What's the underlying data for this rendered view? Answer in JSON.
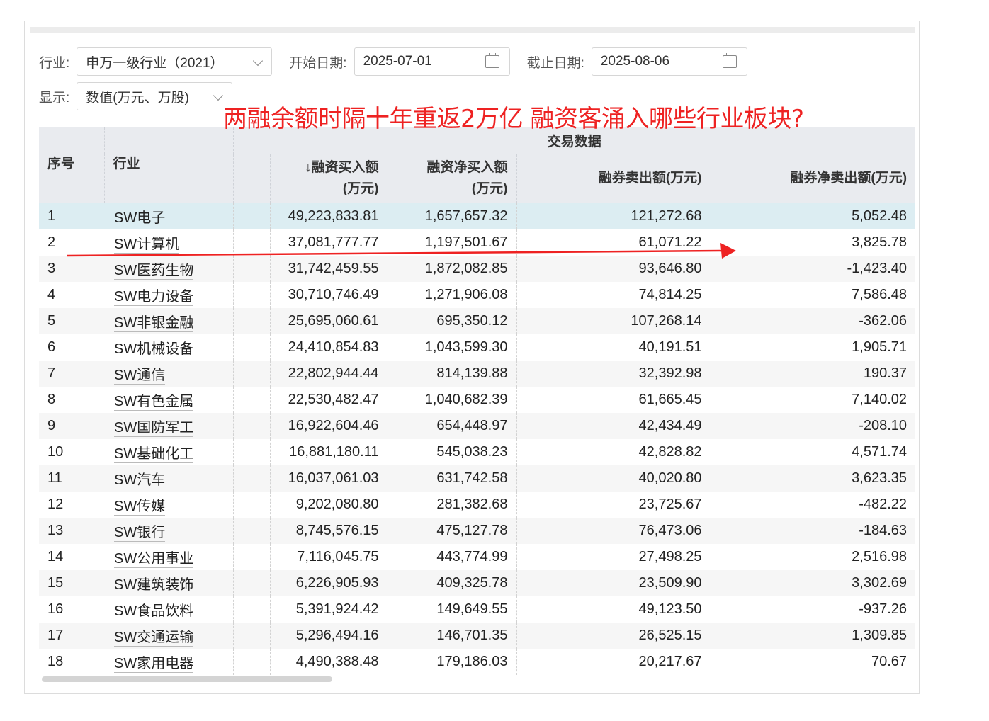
{
  "filters": {
    "industry_label": "行业:",
    "industry_value": "申万一级行业（2021）",
    "start_label": "开始日期:",
    "start_value": "2025-07-01",
    "end_label": "截止日期:",
    "end_value": "2025-08-06",
    "display_label": "显示:",
    "display_value": "数值(万元、万股)"
  },
  "overlay_title": "两融余额时隔十年重返2万亿 融资客涌入哪些行业板块?",
  "table": {
    "headers": {
      "index": "序号",
      "industry": "行业",
      "group": "交易数据",
      "margin_buy_l1": "↓融资买入额",
      "margin_buy_l2": "(万元)",
      "net_buy_l1": "融资净买入额",
      "net_buy_l2": "(万元)",
      "short_sell": "融券卖出额(万元)",
      "net_short_sell": "融券净卖出额(万元)"
    },
    "rows": [
      {
        "idx": "1",
        "industry": "SW电子",
        "buy": "49,223,833.81",
        "net_buy": "1,657,657.32",
        "short": "121,272.68",
        "net_short": "5,052.48"
      },
      {
        "idx": "2",
        "industry": "SW计算机",
        "buy": "37,081,777.77",
        "net_buy": "1,197,501.67",
        "short": "61,071.22",
        "net_short": "3,825.78"
      },
      {
        "idx": "3",
        "industry": "SW医药生物",
        "buy": "31,742,459.55",
        "net_buy": "1,872,082.85",
        "short": "93,646.80",
        "net_short": "-1,423.40"
      },
      {
        "idx": "4",
        "industry": "SW电力设备",
        "buy": "30,710,746.49",
        "net_buy": "1,271,906.08",
        "short": "74,814.25",
        "net_short": "7,586.48"
      },
      {
        "idx": "5",
        "industry": "SW非银金融",
        "buy": "25,695,060.61",
        "net_buy": "695,350.12",
        "short": "107,268.14",
        "net_short": "-362.06"
      },
      {
        "idx": "6",
        "industry": "SW机械设备",
        "buy": "24,410,854.83",
        "net_buy": "1,043,599.30",
        "short": "40,191.51",
        "net_short": "1,905.71"
      },
      {
        "idx": "7",
        "industry": "SW通信",
        "buy": "22,802,944.44",
        "net_buy": "814,139.88",
        "short": "32,392.98",
        "net_short": "190.37"
      },
      {
        "idx": "8",
        "industry": "SW有色金属",
        "buy": "22,530,482.47",
        "net_buy": "1,040,682.39",
        "short": "61,665.45",
        "net_short": "7,140.02"
      },
      {
        "idx": "9",
        "industry": "SW国防军工",
        "buy": "16,922,604.46",
        "net_buy": "654,448.97",
        "short": "42,434.49",
        "net_short": "-208.10"
      },
      {
        "idx": "10",
        "industry": "SW基础化工",
        "buy": "16,881,180.11",
        "net_buy": "545,038.23",
        "short": "42,828.82",
        "net_short": "4,571.74"
      },
      {
        "idx": "11",
        "industry": "SW汽车",
        "buy": "16,037,061.03",
        "net_buy": "631,742.58",
        "short": "40,020.80",
        "net_short": "3,623.35"
      },
      {
        "idx": "12",
        "industry": "SW传媒",
        "buy": "9,202,080.80",
        "net_buy": "281,382.68",
        "short": "23,725.67",
        "net_short": "-482.22"
      },
      {
        "idx": "13",
        "industry": "SW银行",
        "buy": "8,745,576.15",
        "net_buy": "475,127.78",
        "short": "76,473.06",
        "net_short": "-184.63"
      },
      {
        "idx": "14",
        "industry": "SW公用事业",
        "buy": "7,116,045.75",
        "net_buy": "443,774.99",
        "short": "27,498.25",
        "net_short": "2,516.98"
      },
      {
        "idx": "15",
        "industry": "SW建筑装饰",
        "buy": "6,226,905.93",
        "net_buy": "409,325.78",
        "short": "23,509.90",
        "net_short": "3,302.69"
      },
      {
        "idx": "16",
        "industry": "SW食品饮料",
        "buy": "5,391,924.42",
        "net_buy": "149,649.55",
        "short": "49,123.50",
        "net_short": "-937.26"
      },
      {
        "idx": "17",
        "industry": "SW交通运输",
        "buy": "5,296,494.16",
        "net_buy": "146,701.35",
        "short": "26,525.15",
        "net_short": "1,309.85"
      },
      {
        "idx": "18",
        "industry": "SW家用电器",
        "buy": "4,490,388.48",
        "net_buy": "179,186.03",
        "short": "20,217.67",
        "net_short": "70.67"
      }
    ]
  },
  "colors": {
    "overlay_text": "#ee2222",
    "arrow": "#ee2222",
    "header_bg": "#e9ebef",
    "selected_row": "#dcedf2"
  }
}
